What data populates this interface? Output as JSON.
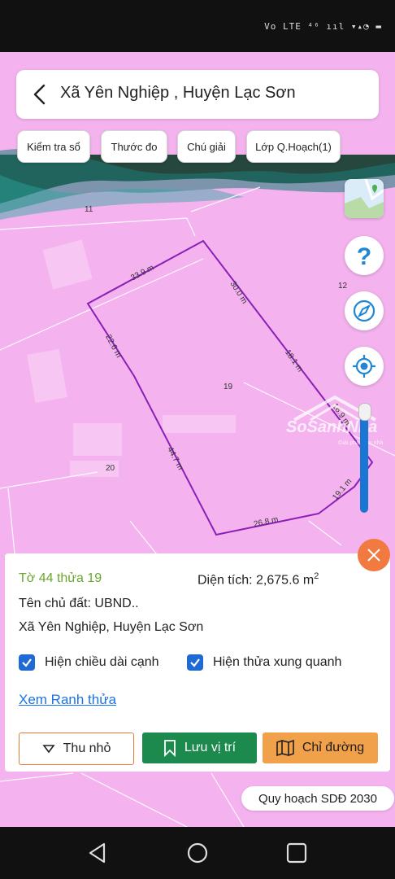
{
  "status_bar": {
    "indicators": "Vo LTE ⁴⁶ ııl ▾▴◔ ▬"
  },
  "header": {
    "title": "Xã Yên Nghiệp , Huyện Lạc Sơn"
  },
  "toolbar": {
    "chips": [
      "Kiểm tra sổ",
      "Thước đo",
      "Chú giải",
      "Lớp Q.Hoạch(1)"
    ]
  },
  "map": {
    "parcel_labels": [
      "11",
      "12",
      "19",
      "20"
    ],
    "edges": [
      "33.9 m",
      "30.0 m",
      "18.1 m",
      "16.9 m",
      "19.1 m",
      "26.8 m",
      "44.7 m",
      "22.6 m"
    ],
    "watermark": "SoSanhNha",
    "watermark_sub": "Giải pháp tìm nhà"
  },
  "map_controls": {
    "icons": [
      "map-layer-icon",
      "help-icon",
      "compass-icon",
      "locate-icon"
    ]
  },
  "info": {
    "parcel_id": "Tờ 44 thửa 19",
    "area_label": "Diện tích: 2,675.6 m",
    "area_unit_sup": "2",
    "owner": "Tên chủ đất: UBND..",
    "address": "Xã Yên Nghiệp, Huyện Lạc Sơn",
    "show_edge_length": "Hiện chiều dài cạnh",
    "show_neighbors": "Hiện thửa xung quanh",
    "boundary_link": "Xem Ranh thửa",
    "collapse_button": "Thu nhỏ",
    "save_button": "Lưu vị trí",
    "route_button": "Chỉ đường"
  },
  "plan_badge": "Quy hoạch SDĐ 2030",
  "colors": {
    "map_pink": "#f4b3ee",
    "parcel_outline": "#8a1fb8",
    "accent_green": "#1b8a4c",
    "accent_orange": "#f2a14b",
    "link_blue": "#1a73e8",
    "checkbox_blue": "#1f6ad4"
  }
}
